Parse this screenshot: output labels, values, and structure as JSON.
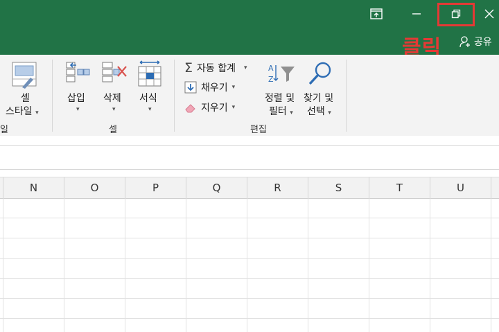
{
  "window": {
    "controls": [
      "ribbon-display-options",
      "minimize",
      "restore-down",
      "close"
    ],
    "share_label": "공유"
  },
  "annotation": {
    "click_label": "클릭",
    "color": "#e53935"
  },
  "ribbon": {
    "style_group": {
      "cell_style_line1": "셀",
      "cell_style_line2": "스타일",
      "group_label_partial": "일"
    },
    "cells_group": {
      "insert": "삽입",
      "delete": "삭제",
      "format": "서식",
      "label": "셀"
    },
    "editing_group": {
      "autosum": "자동 합계",
      "fill": "채우기",
      "clear": "지우기",
      "sort_filter_line1": "정렬 및",
      "sort_filter_line2": "필터",
      "find_select_line1": "찾기 및",
      "find_select_line2": "선택",
      "label": "편집"
    }
  },
  "columns": [
    "N",
    "O",
    "P",
    "Q",
    "R",
    "S",
    "T",
    "U"
  ],
  "colors": {
    "title_bar": "#217346",
    "ribbon_bg": "#f3f3f3"
  }
}
